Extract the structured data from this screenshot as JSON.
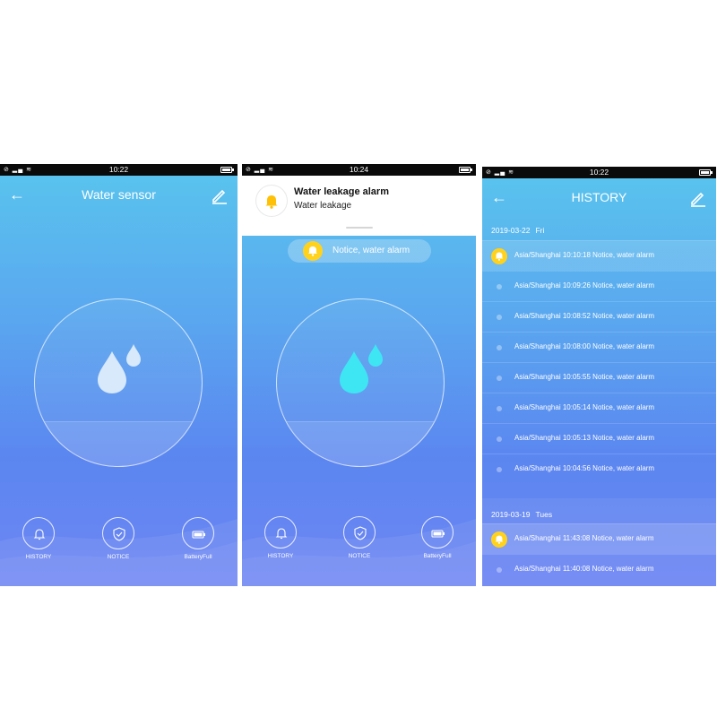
{
  "screens": [
    {
      "status_time": "10:22",
      "title": "Water sensor",
      "buttons": [
        {
          "label": "HISTORY",
          "icon": "bell-icon"
        },
        {
          "label": "NOTICE",
          "icon": "shield-check-icon"
        },
        {
          "label": "BatteryFull",
          "icon": "battery-icon"
        }
      ]
    },
    {
      "status_time": "10:24",
      "notification": {
        "title": "Water leakage alarm",
        "body": "Water leakage"
      },
      "alarm_pill": "Notice, water alarm",
      "buttons": [
        {
          "label": "HISTORY",
          "icon": "bell-icon"
        },
        {
          "label": "NOTICE",
          "icon": "shield-check-icon"
        },
        {
          "label": "BatteryFull",
          "icon": "battery-icon"
        }
      ]
    },
    {
      "status_time": "10:22",
      "title": "HISTORY",
      "groups": [
        {
          "date": "2019-03-22",
          "day": "Fri",
          "entries": [
            "Asia/Shanghai 10:10:18 Notice, water alarm",
            "Asia/Shanghai 10:09:26 Notice, water alarm",
            "Asia/Shanghai 10:08:52 Notice, water alarm",
            "Asia/Shanghai 10:08:00 Notice, water alarm",
            "Asia/Shanghai 10:05:55 Notice, water alarm",
            "Asia/Shanghai 10:05:14 Notice, water alarm",
            "Asia/Shanghai 10:05:13 Notice, water alarm",
            "Asia/Shanghai 10:04:56 Notice, water alarm"
          ]
        },
        {
          "date": "2019-03-19",
          "day": "Tues",
          "entries": [
            "Asia/Shanghai 11:43:08 Notice, water alarm",
            "Asia/Shanghai 11:40:08 Notice, water alarm"
          ]
        }
      ]
    }
  ],
  "colors": {
    "accent_yellow": "#ffd21e",
    "drop_normal": "#d7e9fb",
    "drop_alarm": "#3ee6f4"
  }
}
